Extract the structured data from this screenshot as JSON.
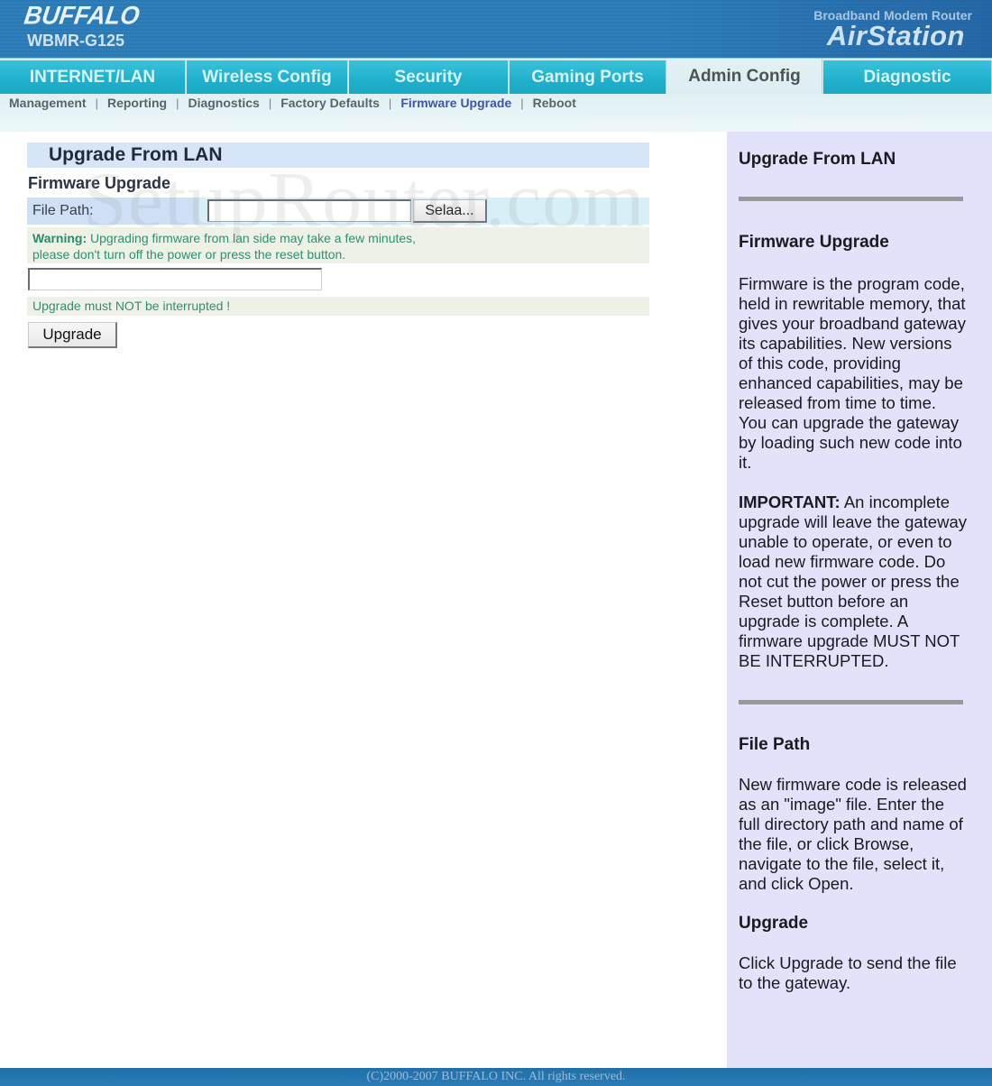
{
  "header": {
    "brand": "BUFFALO",
    "model": "WBMR-G125",
    "product_subtitle": "Broadband Modem Router",
    "product_name": "AirStation"
  },
  "tabs": [
    {
      "label": "INTERNET/LAN",
      "active": false
    },
    {
      "label": "Wireless Config",
      "active": false
    },
    {
      "label": "Security",
      "active": false
    },
    {
      "label": "Gaming Ports",
      "active": false
    },
    {
      "label": "Admin Config",
      "active": true
    },
    {
      "label": "Diagnostic",
      "active": false
    }
  ],
  "subnav": [
    {
      "label": "Management",
      "current": false
    },
    {
      "label": "Reporting",
      "current": false
    },
    {
      "label": "Diagnostics",
      "current": false
    },
    {
      "label": "Factory Defaults",
      "current": false
    },
    {
      "label": "Firmware Upgrade",
      "current": true
    },
    {
      "label": "Reboot",
      "current": false
    }
  ],
  "subnav_separator": "|",
  "main": {
    "section_title": "Upgrade From LAN",
    "subsection_title": "Firmware Upgrade",
    "file_path_label": "File Path:",
    "file_path_value": "",
    "browse_button": "Selaa...",
    "warning_label": "Warning:",
    "warning_text_line1": " Upgrading firmware from lan side may take a few minutes,",
    "warning_text_line2": "please don't turn off the power or press the reset button.",
    "progress_value": "",
    "interrupt_note": "Upgrade must NOT be interrupted !",
    "upgrade_button": "Upgrade"
  },
  "watermark": "SetupRouter.com",
  "help": {
    "upgrade_lan_title": "Upgrade From LAN",
    "firmware_title": "Firmware Upgrade",
    "firmware_text": "Firmware is the program code, held in rewritable memory, that gives your broadband gateway its capabilities. New versions of this code, providing enhanced capabilities, may be released from time to time. You can upgrade the gateway by loading such new code into it.",
    "important_label": "IMPORTANT:",
    "important_text": " An incomplete upgrade will leave the gateway unable to operate, or even to load new firmware code. Do not cut the power or press the Reset button before an upgrade is complete. A firmware upgrade MUST NOT BE INTERRUPTED.",
    "file_path_title": "File Path",
    "file_path_text": "New firmware code is released as an \"image\" file. Enter the full directory path and name of the file, or click Browse, navigate to the file, select it, and click Open.",
    "upgrade_title": "Upgrade",
    "upgrade_text": "Click Upgrade to send the file to the gateway."
  },
  "footer": {
    "copyright": "(C)2000-2007 BUFFALO INC. All rights reserved."
  }
}
